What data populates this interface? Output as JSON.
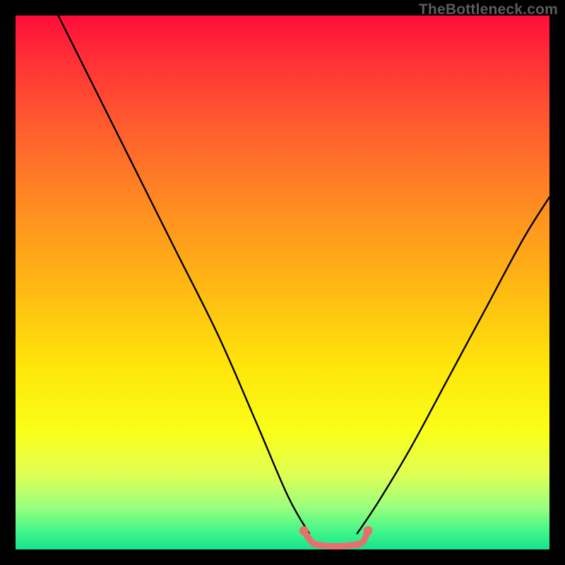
{
  "watermark": "TheBottleneck.com",
  "chart_data": {
    "type": "line",
    "title": "",
    "xlabel": "",
    "ylabel": "",
    "xlim": [
      0,
      100
    ],
    "ylim": [
      0,
      100
    ],
    "grid": false,
    "legend": false,
    "series": [
      {
        "name": "left-curve",
        "color": "#000000",
        "x": [
          8,
          15,
          22,
          30,
          38,
          45,
          51,
          55
        ],
        "values": [
          100,
          86,
          72,
          56,
          40,
          24,
          10,
          3
        ]
      },
      {
        "name": "right-curve",
        "color": "#000000",
        "x": [
          64,
          68,
          74,
          81,
          88,
          95,
          100
        ],
        "values": [
          3,
          9,
          19,
          32,
          45,
          58,
          66
        ]
      },
      {
        "name": "bottom-plateau",
        "color": "#e67070",
        "x": [
          54,
          55.5,
          57,
          60,
          63,
          65,
          66
        ],
        "values": [
          3.5,
          1.4,
          0.8,
          0.6,
          0.8,
          1.4,
          3.5
        ]
      }
    ],
    "background_gradient": {
      "top": "#ff0d3a",
      "mid": "#ffe60a",
      "bottom": "#19e18c"
    }
  }
}
